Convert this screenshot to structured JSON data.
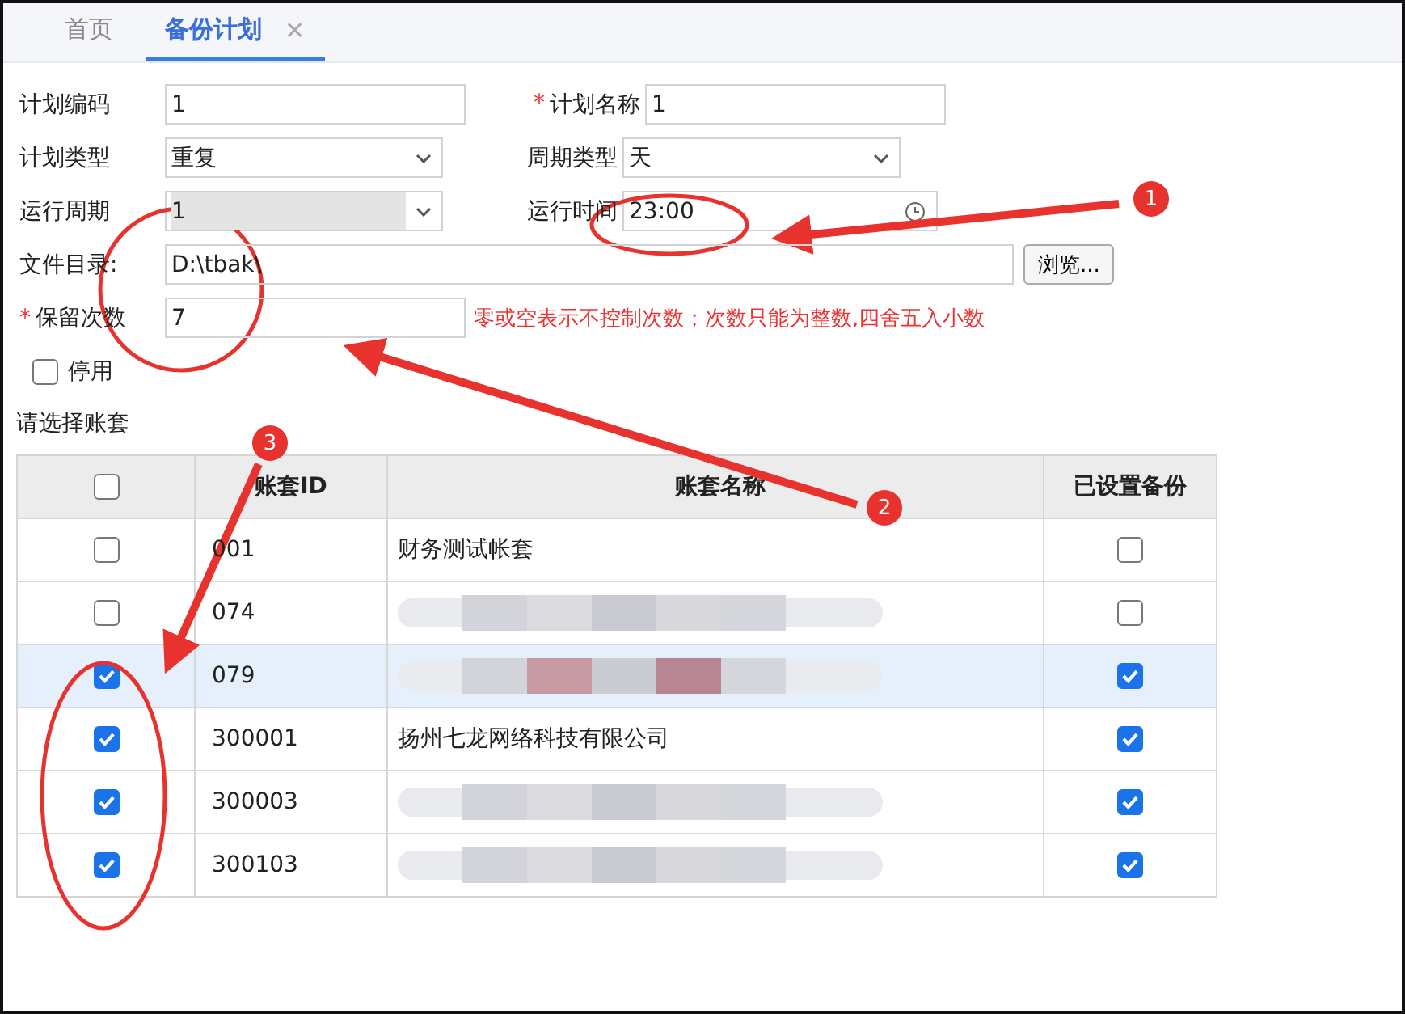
{
  "tabs": [
    {
      "label": "首页",
      "selected": false
    },
    {
      "label": "备份计划",
      "selected": true,
      "close_symbol": "✕"
    }
  ],
  "required_mark": "*",
  "form": {
    "plan_code": {
      "label": "计划编码",
      "value": "1"
    },
    "plan_name": {
      "label": "计划名称",
      "value": "1",
      "required": true
    },
    "plan_type": {
      "label": "计划类型",
      "value": "重复"
    },
    "cycle_type": {
      "label": "周期类型",
      "value": "天"
    },
    "run_cycle": {
      "label": "运行周期",
      "value": "1",
      "disabled": true
    },
    "run_time": {
      "label": "运行时间",
      "value": "23:00"
    },
    "file_dir": {
      "label": "文件目录:",
      "value": "D:\\tbak\\"
    },
    "browse_button": "浏览...",
    "keep_count": {
      "label": "保留次数",
      "value": "7",
      "required": true,
      "hint": "零或空表示不控制次数；次数只能为整数,四舍五入小数"
    },
    "disable": {
      "label": "停用",
      "checked": false
    }
  },
  "table_title": "请选择账套",
  "table": {
    "header_checked": false,
    "columns": [
      "账套ID",
      "账套名称",
      "已设置备份"
    ],
    "rows": [
      {
        "checked": false,
        "id": "001",
        "name": "财务测试帐套",
        "redacted": false,
        "backup": false,
        "selected": false
      },
      {
        "checked": false,
        "id": "074",
        "redacted": true,
        "backup": false,
        "selected": false
      },
      {
        "checked": true,
        "id": "079",
        "redacted": true,
        "backup": true,
        "selected": true
      },
      {
        "checked": true,
        "id": "300001",
        "name": "扬州七龙网络科技有限公司",
        "redacted": false,
        "backup": true,
        "selected": false
      },
      {
        "checked": true,
        "id": "300003",
        "redacted": true,
        "backup": true,
        "selected": false
      },
      {
        "checked": true,
        "id": "300103",
        "redacted": true,
        "backup": true,
        "selected": false
      }
    ]
  },
  "annotations": [
    {
      "number": "1"
    },
    {
      "number": "2"
    },
    {
      "number": "3"
    }
  ]
}
